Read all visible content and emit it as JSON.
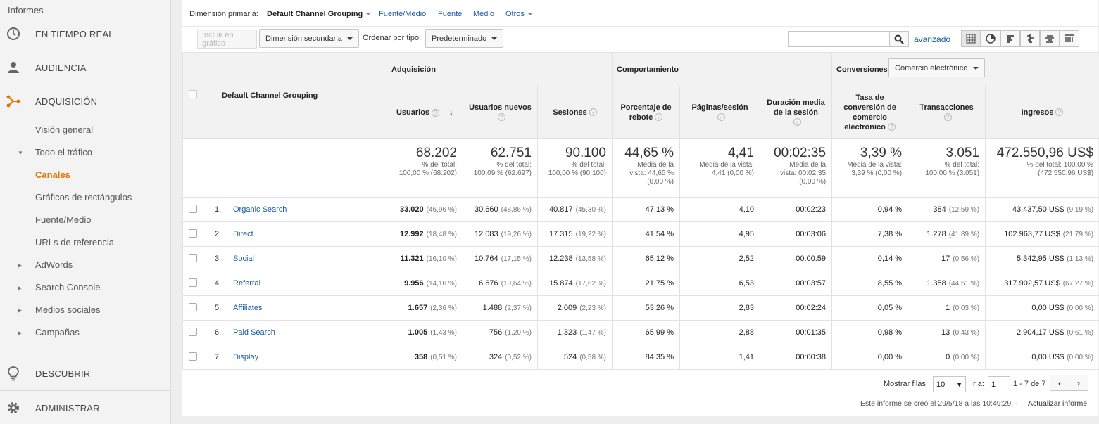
{
  "sidebar": {
    "header": "Informes",
    "items": [
      {
        "label": "EN TIEMPO REAL",
        "icon": "clock-icon"
      },
      {
        "label": "AUDIENCIA",
        "icon": "person-icon"
      },
      {
        "label": "ADQUISICIÓN",
        "icon": "acquisition-icon"
      }
    ],
    "sub_items": [
      {
        "label": "Visión general"
      },
      {
        "label": "Todo el tráfico"
      },
      {
        "label": "Canales"
      },
      {
        "label": "Gráficos de rectángulos"
      },
      {
        "label": "Fuente/Medio"
      },
      {
        "label": "URLs de referencia"
      },
      {
        "label": "AdWords"
      },
      {
        "label": "Search Console"
      },
      {
        "label": "Medios sociales"
      },
      {
        "label": "Campañas"
      }
    ],
    "bottom": [
      {
        "label": "DESCUBRIR",
        "icon": "lightbulb-icon"
      },
      {
        "label": "ADMINISTRAR",
        "icon": "gear-icon"
      }
    ],
    "accent": "#e37400"
  },
  "dimension_bar": {
    "label": "Dimensión primaria:",
    "active": "Default Channel Grouping",
    "links": [
      "Fuente/Medio",
      "Fuente",
      "Medio",
      "Otros"
    ]
  },
  "toolbar": {
    "include_chart": "Incluir en gráfico",
    "secondary_dimension": "Dimensión secundaria",
    "sort_label": "Ordenar por tipo:",
    "sort_value": "Predeterminado",
    "search_placeholder": "",
    "advanced": "avanzado"
  },
  "table": {
    "dimension_header": "Default Channel Grouping",
    "groups": {
      "acquisition": "Adquisición",
      "behavior": "Comportamiento",
      "conversions": "Conversiones",
      "conversions_select": "Comercio electrónico"
    },
    "columns": {
      "users": "Usuarios",
      "new_users": "Usuarios nuevos",
      "sessions": "Sesiones",
      "bounce": "Porcentaje de rebote",
      "pages": "Páginas/sesión",
      "duration": "Duración media de la sesión",
      "conv_rate": "Tasa de conversión de comercio electrónico",
      "transactions": "Transacciones",
      "revenue": "Ingresos"
    },
    "totals": {
      "users": {
        "value": "68.202",
        "sub1": "% del total:",
        "sub2": "100,00 % (68.202)"
      },
      "new_users": {
        "value": "62.751",
        "sub1": "% del total:",
        "sub2": "100,09 % (62.697)"
      },
      "sessions": {
        "value": "90.100",
        "sub1": "% del total:",
        "sub2": "100,00 % (90.100)"
      },
      "bounce": {
        "value": "44,65 %",
        "sub1": "Media de la",
        "sub2": "vista: 44,65 %",
        "sub3": "(0,00 %)"
      },
      "pages": {
        "value": "4,41",
        "sub1": "Media de la vista:",
        "sub2": "4,41 (0,00 %)"
      },
      "duration": {
        "value": "00:02:35",
        "sub1": "Media de la",
        "sub2": "vista: 00:02:35",
        "sub3": "(0,00 %)"
      },
      "conv_rate": {
        "value": "3,39 %",
        "sub1": "Media de la vista:",
        "sub2": "3,39 % (0,00 %)"
      },
      "transactions": {
        "value": "3.051",
        "sub1": "% del total:",
        "sub2": "100,00 % (3.051)"
      },
      "revenue": {
        "value": "472.550,96 US$",
        "sub1": "% del total: 100,00 %",
        "sub2": "(472.550,96 US$)"
      }
    },
    "rows": [
      {
        "idx": "1.",
        "name": "Organic Search",
        "users": "33.020",
        "users_pct": "(46,96 %)",
        "new_users": "30.660",
        "new_users_pct": "(48,86 %)",
        "sessions": "40.817",
        "sessions_pct": "(45,30 %)",
        "bounce": "47,13 %",
        "pages": "4,10",
        "duration": "00:02:23",
        "conv_rate": "0,94 %",
        "transactions": "384",
        "transactions_pct": "(12,59 %)",
        "revenue": "43.437,50 US$",
        "revenue_pct": "(9,19 %)"
      },
      {
        "idx": "2.",
        "name": "Direct",
        "users": "12.992",
        "users_pct": "(18,48 %)",
        "new_users": "12.083",
        "new_users_pct": "(19,26 %)",
        "sessions": "17.315",
        "sessions_pct": "(19,22 %)",
        "bounce": "41,54 %",
        "pages": "4,95",
        "duration": "00:03:06",
        "conv_rate": "7,38 %",
        "transactions": "1.278",
        "transactions_pct": "(41,89 %)",
        "revenue": "102.963,77 US$",
        "revenue_pct": "(21,79 %)"
      },
      {
        "idx": "3.",
        "name": "Social",
        "users": "11.321",
        "users_pct": "(16,10 %)",
        "new_users": "10.764",
        "new_users_pct": "(17,15 %)",
        "sessions": "12.238",
        "sessions_pct": "(13,58 %)",
        "bounce": "65,12 %",
        "pages": "2,52",
        "duration": "00:00:59",
        "conv_rate": "0,14 %",
        "transactions": "17",
        "transactions_pct": "(0,56 %)",
        "revenue": "5.342,95 US$",
        "revenue_pct": "(1,13 %)"
      },
      {
        "idx": "4.",
        "name": "Referral",
        "users": "9.956",
        "users_pct": "(14,16 %)",
        "new_users": "6.676",
        "new_users_pct": "(10,64 %)",
        "sessions": "15.874",
        "sessions_pct": "(17,62 %)",
        "bounce": "21,75 %",
        "pages": "6,53",
        "duration": "00:03:57",
        "conv_rate": "8,55 %",
        "transactions": "1.358",
        "transactions_pct": "(44,51 %)",
        "revenue": "317.902,57 US$",
        "revenue_pct": "(67,27 %)"
      },
      {
        "idx": "5.",
        "name": "Affiliates",
        "users": "1.657",
        "users_pct": "(2,36 %)",
        "new_users": "1.488",
        "new_users_pct": "(2,37 %)",
        "sessions": "2.009",
        "sessions_pct": "(2,23 %)",
        "bounce": "53,26 %",
        "pages": "2,83",
        "duration": "00:02:24",
        "conv_rate": "0,05 %",
        "transactions": "1",
        "transactions_pct": "(0,03 %)",
        "revenue": "0,00 US$",
        "revenue_pct": "(0,00 %)"
      },
      {
        "idx": "6.",
        "name": "Paid Search",
        "users": "1.005",
        "users_pct": "(1,43 %)",
        "new_users": "756",
        "new_users_pct": "(1,20 %)",
        "sessions": "1.323",
        "sessions_pct": "(1,47 %)",
        "bounce": "65,99 %",
        "pages": "2,88",
        "duration": "00:01:35",
        "conv_rate": "0,98 %",
        "transactions": "13",
        "transactions_pct": "(0,43 %)",
        "revenue": "2.904,17 US$",
        "revenue_pct": "(0,61 %)"
      },
      {
        "idx": "7.",
        "name": "Display",
        "users": "358",
        "users_pct": "(0,51 %)",
        "new_users": "324",
        "new_users_pct": "(0,52 %)",
        "sessions": "524",
        "sessions_pct": "(0,58 %)",
        "bounce": "84,35 %",
        "pages": "1,41",
        "duration": "00:00:38",
        "conv_rate": "0,00 %",
        "transactions": "0",
        "transactions_pct": "(0,00 %)",
        "revenue": "0,00 US$",
        "revenue_pct": "(0,00 %)"
      }
    ]
  },
  "footer": {
    "show_rows_label": "Mostrar filas:",
    "show_rows_value": "10",
    "goto_label": "Ir a:",
    "goto_value": "1",
    "range": "1 - 7 de 7",
    "report_created": "Este informe se creó el 29/5/18 a las 10:49:29. -",
    "refresh_link": "Actualizar informe"
  }
}
